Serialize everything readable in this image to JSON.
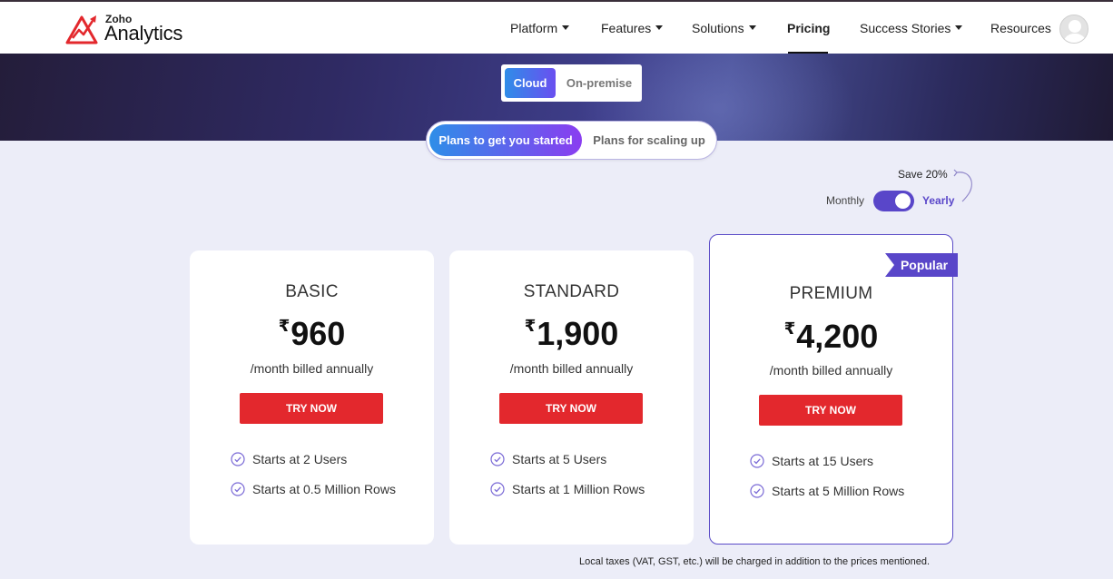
{
  "brand": {
    "small": "Zoho",
    "name": "Analytics"
  },
  "nav": {
    "platform": "Platform",
    "features": "Features",
    "solutions": "Solutions",
    "pricing": "Pricing",
    "success_stories": "Success Stories",
    "resources": "Resources"
  },
  "deployment": {
    "cloud": "Cloud",
    "on_premise": "On-premise"
  },
  "plan_groups": {
    "started": "Plans to get you started",
    "scaling": "Plans for scaling up"
  },
  "billing": {
    "save": "Save 20%",
    "monthly": "Monthly",
    "yearly": "Yearly",
    "yearly_selected": true
  },
  "plans": [
    {
      "name": "BASIC",
      "currency": "₹",
      "price": "960",
      "period": "/month billed annually",
      "cta": "TRY NOW",
      "features": [
        "Starts at 2 Users",
        "Starts at 0.5 Million Rows"
      ]
    },
    {
      "name": "STANDARD",
      "currency": "₹",
      "price": "1,900",
      "period": "/month billed annually",
      "cta": "TRY NOW",
      "features": [
        "Starts at 5 Users",
        "Starts at 1 Million Rows"
      ]
    },
    {
      "name": "PREMIUM",
      "currency": "₹",
      "price": "4,200",
      "period": "/month billed annually",
      "cta": "TRY NOW",
      "badge": "Popular",
      "features": [
        "Starts at 15 Users",
        "Starts at 5 Million Rows"
      ]
    }
  ],
  "footnote": "Local taxes (VAT, GST, etc.) will be charged in addition to the prices mentioned.",
  "colors": {
    "accent": "#5946c9",
    "cta": "#e3282d",
    "page_bg": "#ecedf8"
  }
}
